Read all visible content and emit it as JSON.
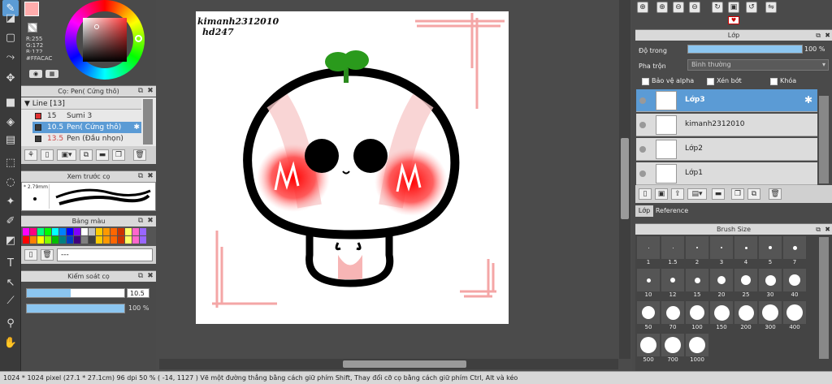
{
  "canvas": {
    "watermark_line1": "kimanh2312010",
    "watermark_line2": "hd247"
  },
  "color_panel": {
    "r": "R:255",
    "g": "G:172",
    "b": "B:172",
    "hex": "#FFACAC",
    "current_color": "#FFACAC"
  },
  "brush_panel": {
    "title": "Cọ: Pen( Cứng thô)",
    "group_label": "Line [13]",
    "items": [
      {
        "size": "15",
        "name": "Sumi 3",
        "color": "#e03030"
      },
      {
        "size": "10.5",
        "name": "Pen( Cứng thô)",
        "color": "#3a3a3a"
      },
      {
        "size": "13.5",
        "name": "Pen (Đầu nhọn)",
        "color": "#3a3a3a"
      }
    ]
  },
  "preview_panel": {
    "title": "Xem trước cọ",
    "size_label": "2.79mm"
  },
  "palette_panel": {
    "title": "Bảng màu",
    "footer": "---",
    "colors": [
      "#ff00ff",
      "#ff0080",
      "#00ff80",
      "#00ff00",
      "#00ffff",
      "#0080ff",
      "#0000ff",
      "#8000ff",
      "#ffffff",
      "#c0c0c0",
      "#ff0000",
      "#ff8000",
      "#ffff00",
      "#80ff00",
      "#00c000",
      "#008080",
      "#0040c0",
      "#400080",
      "#808080",
      "#404040"
    ]
  },
  "brush_control": {
    "title": "Kiểm soát cọ",
    "size_value": "10.5",
    "opacity_value": "100 %",
    "size_fraction": 0.45,
    "opacity_fraction": 1.0
  },
  "layer_panel": {
    "title": "Lớp",
    "opacity_label": "Độ trong",
    "opacity_value": "100 %",
    "blend_label": "Pha trộn",
    "blend_value": "Bình thường",
    "protect_alpha": "Bảo vệ alpha",
    "clipping": "Xén bớt",
    "lock": "Khóa",
    "layers": [
      {
        "name": "Lớp3",
        "selected": true
      },
      {
        "name": "kimanh2312010",
        "selected": false
      },
      {
        "name": "Lớp2",
        "selected": false
      },
      {
        "name": "Lớp1",
        "selected": false
      }
    ],
    "tab_layer": "Lớp",
    "tab_reference": "Reference"
  },
  "brush_size_panel": {
    "title": "Brush Size",
    "sizes": [
      "1",
      "1.5",
      "2",
      "3",
      "4",
      "5",
      "7",
      "10",
      "12",
      "15",
      "20",
      "25",
      "30",
      "40",
      "50",
      "70",
      "100",
      "150",
      "200",
      "300",
      "400",
      "500",
      "700",
      "1000"
    ]
  },
  "status_bar": {
    "text": "1024 * 1024 pixel   (27.1 * 27.1cm)   96 dpi   50 %   ( -14, 1127 )   Vẽ một đường thẳng bằng cách giữ phím Shift, Thay đổi cỡ cọ bằng cách giữ phím Ctrl, Alt và kéo"
  },
  "colors": {
    "accent": "#5b9bd5",
    "panel": "#dcdcdc"
  }
}
